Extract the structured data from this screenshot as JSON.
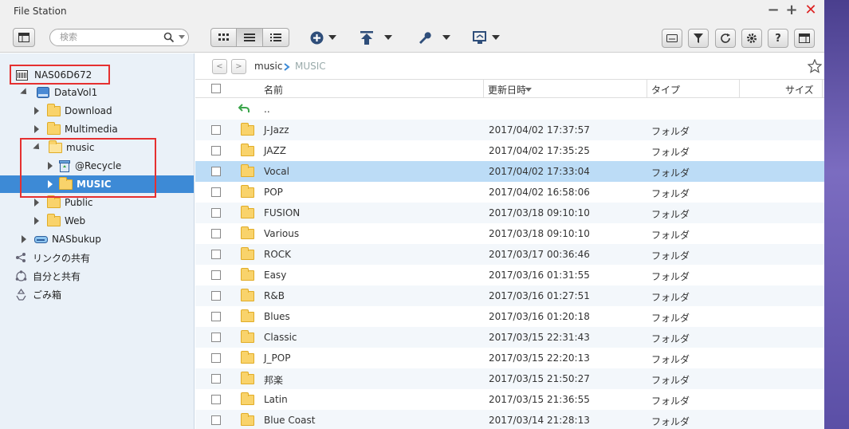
{
  "window": {
    "title": "File Station",
    "controls": [
      "−",
      "+",
      "✕"
    ]
  },
  "toolbar": {
    "search_placeholder": "検索"
  },
  "sidebar": {
    "root": "NAS06D672",
    "volume": "DataVol1",
    "folders": [
      {
        "label": "Download"
      },
      {
        "label": "Multimedia"
      },
      {
        "label": "music"
      },
      {
        "label": "@Recycle"
      },
      {
        "label": "MUSIC"
      },
      {
        "label": "Public"
      },
      {
        "label": "Web"
      }
    ],
    "nas_backup": "NASbukup",
    "link_share": "リンクの共有",
    "shared_with_me": "自分と共有",
    "recycle_bin": "ごみ箱"
  },
  "breadcrumb": {
    "back": "<",
    "forward": ">",
    "parent": "music",
    "current": "MUSIC"
  },
  "columns": {
    "name": "名前",
    "modified": "更新日時",
    "type": "タイプ",
    "size": "サイズ"
  },
  "parent_row": "..",
  "files": [
    {
      "name": "J-Jazz",
      "date": "2017/04/02 17:37:57",
      "type": "フォルダ"
    },
    {
      "name": "JAZZ",
      "date": "2017/04/02 17:35:25",
      "type": "フォルダ"
    },
    {
      "name": "Vocal",
      "date": "2017/04/02 17:33:04",
      "type": "フォルダ"
    },
    {
      "name": "POP",
      "date": "2017/04/02 16:58:06",
      "type": "フォルダ"
    },
    {
      "name": "FUSION",
      "date": "2017/03/18 09:10:10",
      "type": "フォルダ"
    },
    {
      "name": "Various",
      "date": "2017/03/18 09:10:10",
      "type": "フォルダ"
    },
    {
      "name": "ROCK",
      "date": "2017/03/17 00:36:46",
      "type": "フォルダ"
    },
    {
      "name": "Easy",
      "date": "2017/03/16 01:31:55",
      "type": "フォルダ"
    },
    {
      "name": "R&B",
      "date": "2017/03/16 01:27:51",
      "type": "フォルダ"
    },
    {
      "name": "Blues",
      "date": "2017/03/16 01:20:18",
      "type": "フォルダ"
    },
    {
      "name": "Classic",
      "date": "2017/03/15 22:31:43",
      "type": "フォルダ"
    },
    {
      "name": "J_POP",
      "date": "2017/03/15 22:20:13",
      "type": "フォルダ"
    },
    {
      "name": "邦楽",
      "date": "2017/03/15 21:50:27",
      "type": "フォルダ"
    },
    {
      "name": "Latin",
      "date": "2017/03/15 21:36:55",
      "type": "フォルダ"
    },
    {
      "name": "Blue Coast",
      "date": "2017/03/14 21:28:13",
      "type": "フォルダ"
    }
  ],
  "colors": {
    "selection": "#3d8ad6",
    "row_selected": "#bcdcf6",
    "highlight_box": "#e53030"
  }
}
